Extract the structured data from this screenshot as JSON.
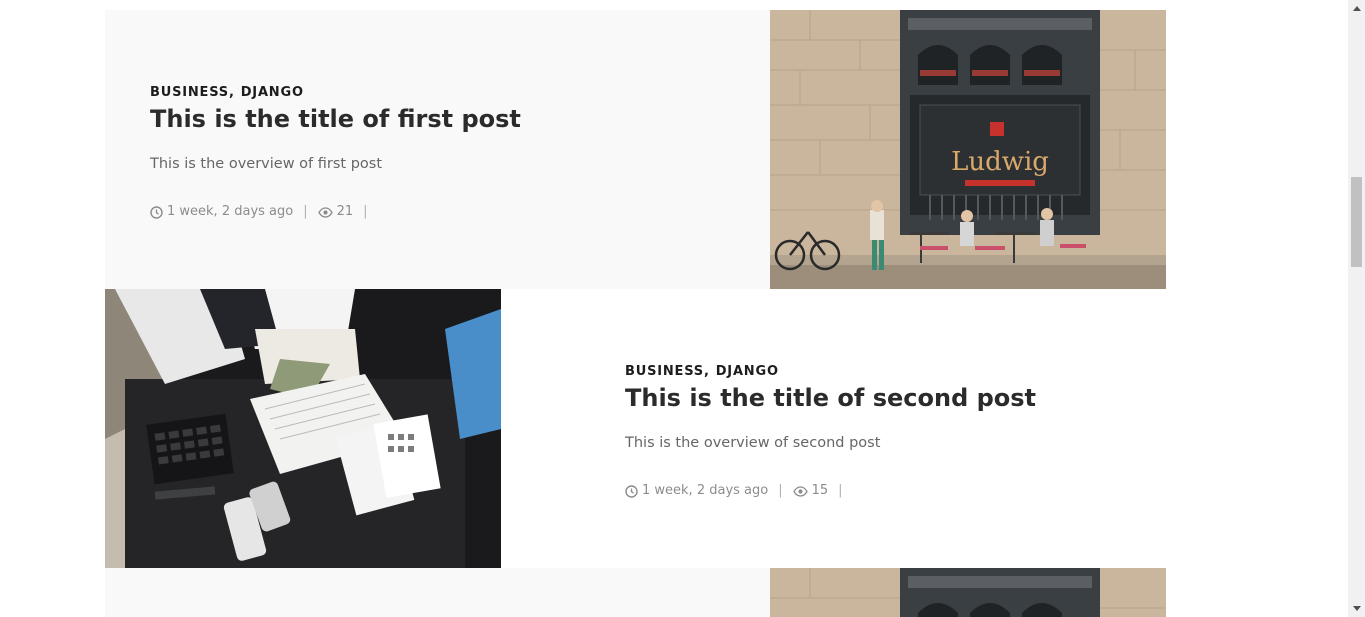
{
  "posts": [
    {
      "categories": [
        "BUSINESS",
        "DJANGO"
      ],
      "title": "This is the title of first post",
      "overview": "This is the overview of first post",
      "time_ago": "1 week, 2 days ago",
      "views": "21",
      "image": "cafe-storefront-photo"
    },
    {
      "categories": [
        "BUSINESS",
        "DJANGO"
      ],
      "title": "This is the title of second post",
      "overview": "This is the overview of second post",
      "time_ago": "1 week, 2 days ago",
      "views": "15",
      "image": "money-counting-desk-photo"
    },
    {
      "image": "cafe-storefront-photo"
    }
  ],
  "colors": {
    "accent_text": "#2b2b2b",
    "muted_text": "#8c8c8c",
    "alt_background": "#f9f9f9"
  },
  "icons": {
    "time": "clock-icon",
    "views": "eye-icon"
  }
}
